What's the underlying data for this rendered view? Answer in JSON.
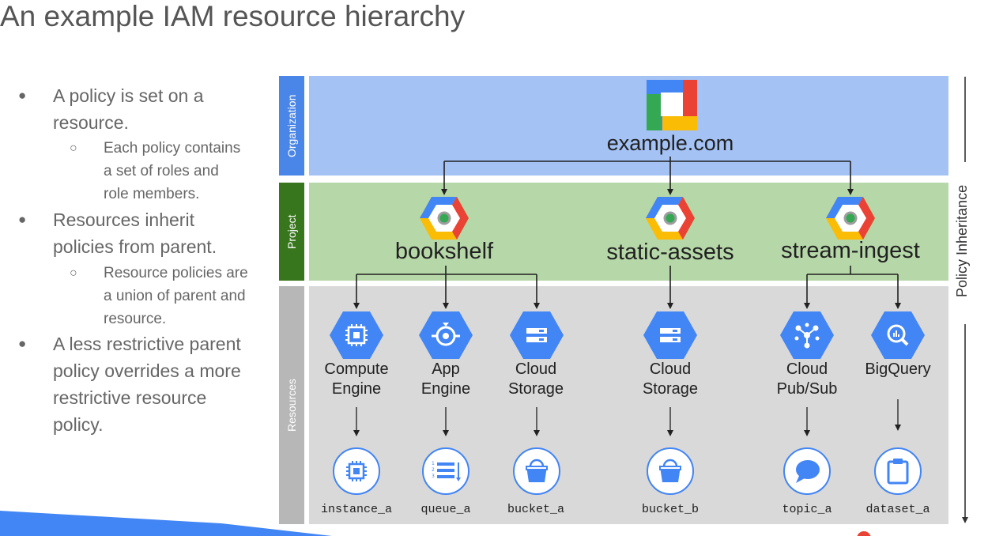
{
  "title": "An example IAM resource hierarchy",
  "bullets": [
    {
      "text": "A policy is set on a resource.",
      "lines": [
        "A policy is set on a",
        "resource."
      ]
    },
    {
      "text": "Each policy contains a set of roles and role members.",
      "lines": [
        "Each policy contains",
        "a set of roles and",
        "role members."
      ]
    },
    {
      "text": "Resources inherit policies from parent.",
      "lines": [
        "Resources inherit",
        "policies from parent."
      ]
    },
    {
      "text": "Resource policies are a union of parent and resource.",
      "lines": [
        "Resource policies are",
        "a union of parent and",
        "resource."
      ]
    },
    {
      "text": "A less restrictive parent policy overrides a more restrictive resource policy.",
      "lines": [
        "A less restrictive parent",
        "policy overrides a more",
        "restrictive resource",
        "policy."
      ]
    }
  ],
  "bands": {
    "organization": {
      "label": "Organization",
      "color": "#a4c2f4",
      "tab_color": "#4a86e8"
    },
    "project": {
      "label": "Project",
      "color": "#b6d7a8",
      "tab_color": "#38761d"
    },
    "resources": {
      "label": "Resources",
      "color": "#d9d9d9",
      "tab_color": "#b7b7b7"
    }
  },
  "organization": {
    "name": "example.com",
    "icon": "gcp-organization-logo-icon"
  },
  "projects": [
    {
      "name": "bookshelf",
      "icon": "project-hexagon-icon"
    },
    {
      "name": "static-assets",
      "icon": "project-hexagon-icon"
    },
    {
      "name": "stream-ingest",
      "icon": "project-hexagon-icon"
    }
  ],
  "services": [
    {
      "line1": "Compute",
      "line2": "Engine",
      "icon": "compute-engine-icon",
      "resource": "instance_a",
      "resource_icon": "chip-icon"
    },
    {
      "line1": "App",
      "line2": "Engine",
      "icon": "app-engine-icon",
      "resource": "queue_a",
      "resource_icon": "queue-list-icon"
    },
    {
      "line1": "Cloud",
      "line2": "Storage",
      "icon": "cloud-storage-icon",
      "resource": "bucket_a",
      "resource_icon": "bucket-icon"
    },
    {
      "line1": "Cloud",
      "line2": "Storage",
      "icon": "cloud-storage-icon",
      "resource": "bucket_b",
      "resource_icon": "bucket-icon"
    },
    {
      "line1": "Cloud",
      "line2": "Pub/Sub",
      "icon": "cloud-pubsub-icon",
      "resource": "topic_a",
      "resource_icon": "speech-bubble-icon"
    },
    {
      "line1": "BigQuery",
      "line2": "",
      "icon": "bigquery-icon",
      "resource": "dataset_a",
      "resource_icon": "clipboard-icon"
    }
  ],
  "inheritance_label": "Policy Inheritance",
  "colors": {
    "gcp_blue": "#4285f4",
    "gcp_red": "#ea4335",
    "gcp_yellow": "#fbbc05",
    "gcp_green": "#34a853",
    "footer_bar": "#4285f4"
  }
}
